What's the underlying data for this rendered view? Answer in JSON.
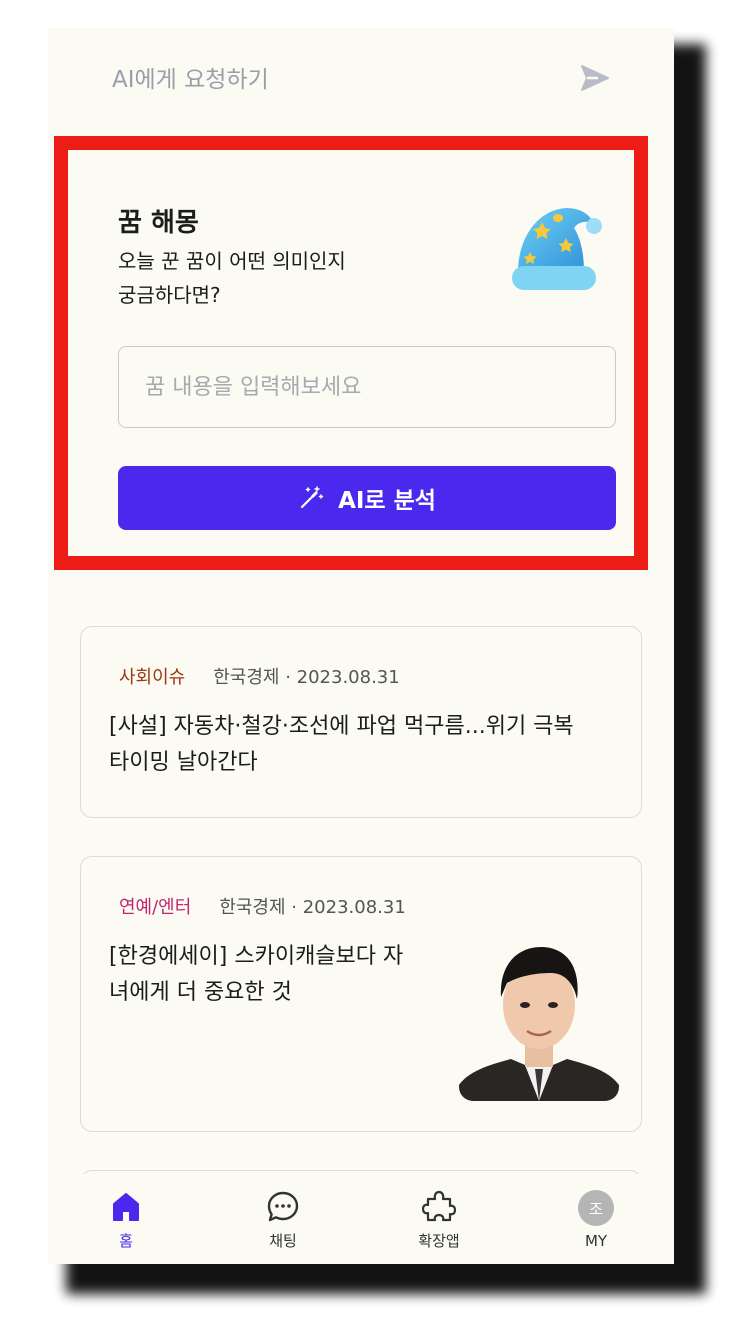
{
  "ai_bar": {
    "placeholder": "AI에게 요청하기",
    "send_icon": "send-icon"
  },
  "dream": {
    "title": "꿈 해몽",
    "subtitle_line1": "오늘 꾼 꿈이 어떤 의미인지",
    "subtitle_line2": "궁금하다면?",
    "input_placeholder": "꿈 내용을 입력해보세요",
    "input_value": "",
    "button_label": "AI로 분석",
    "highlight_color": "#ee1c17",
    "accent_color": "#4a28ee"
  },
  "news": [
    {
      "category": "사회이슈",
      "source": "한국경제 · 2023.08.31",
      "title_line1": "[사설] 자동차·철강·조선에 파업 먹구름...위기 극복",
      "title_line2": "타이밍 날아간다"
    },
    {
      "category": "연예/엔터",
      "source": "한국경제 · 2023.08.31",
      "title_line1": "[한경에세이] 스카이캐슬보다 자",
      "title_line2": "녀에게 더 중요한 것"
    }
  ],
  "bottom_nav": [
    {
      "label": "홈",
      "icon": "home-icon",
      "active": true
    },
    {
      "label": "채팅",
      "icon": "chat-icon",
      "active": false
    },
    {
      "label": "확장앱",
      "icon": "puzzle-icon",
      "active": false
    },
    {
      "label": "MY",
      "icon": "avatar",
      "avatar_text": "조",
      "active": false
    }
  ]
}
